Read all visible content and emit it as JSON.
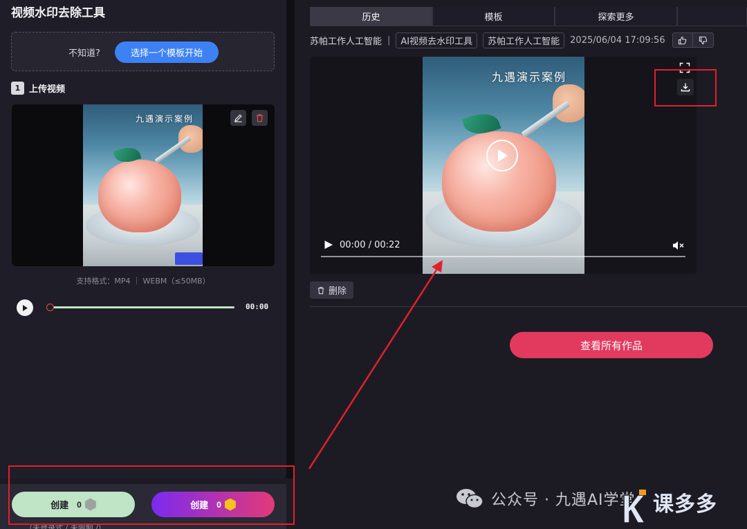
{
  "left": {
    "title": "视频水印去除工具",
    "hint_text": "不知道?",
    "hint_button": "选择一个模板开始",
    "step_number": "1",
    "step_label": "上传视频",
    "watermark_text": "九遇演示案例",
    "formats": "支持格式：MP4 ｜ WEBM（≤50MB）",
    "player_time": "00:00"
  },
  "bottom": {
    "create_free_label": "创建",
    "create_free_cost": "0",
    "create_paid_label": "创建",
    "create_paid_cost": "0",
    "note": "（未登录式 / 未限制 /）"
  },
  "tabs": [
    "历史",
    "模板",
    "探索更多"
  ],
  "meta": {
    "source": "苏帕工作人工智能",
    "tag1": "AI视频去水印工具",
    "tag2": "苏帕工作人工智能",
    "date": "2025/06/04 17:09:56"
  },
  "video": {
    "time": "00:00 / 00:22"
  },
  "actions": {
    "delete": "删除",
    "view_all": "查看所有作品"
  },
  "footer": {
    "wechat": "公众号 · 九遇AI学堂",
    "brand": "课多多"
  },
  "colors": {
    "accent_blue": "#3d82f5",
    "accent_pink": "#e23a5e",
    "annotation_red": "#e3202a"
  }
}
